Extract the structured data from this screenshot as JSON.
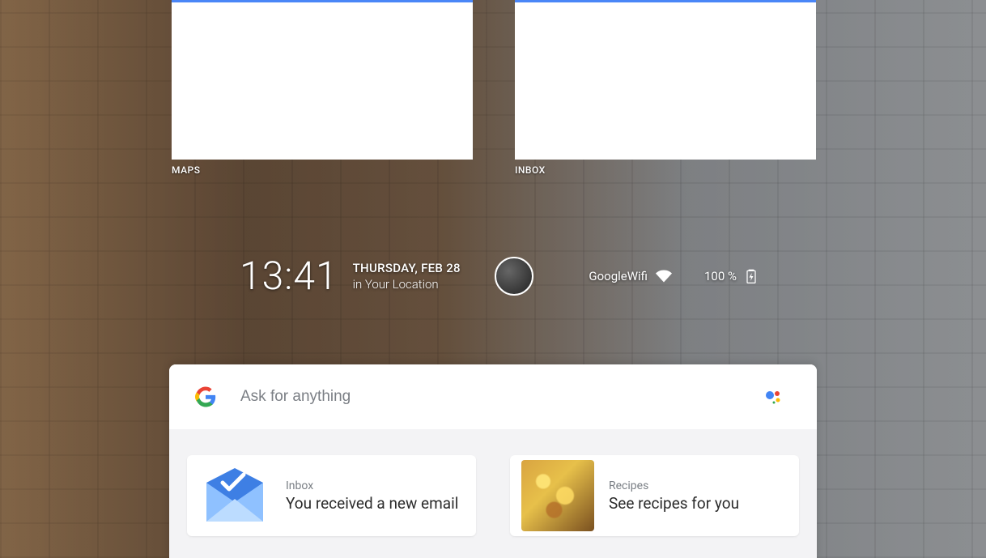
{
  "widgets": [
    {
      "label": "MAPS"
    },
    {
      "label": "INBOX"
    }
  ],
  "status": {
    "time": "13:41",
    "date_line1": "THURSDAY, FEB 28",
    "date_line2": "in Your Location",
    "wifi_name": "GoogleWifi",
    "battery_pct": "100 %"
  },
  "search": {
    "placeholder": "Ask for anything"
  },
  "cards": [
    {
      "title": "Inbox",
      "body": "You received a new email"
    },
    {
      "title": "Recipes",
      "body": "See recipes for you"
    }
  ]
}
